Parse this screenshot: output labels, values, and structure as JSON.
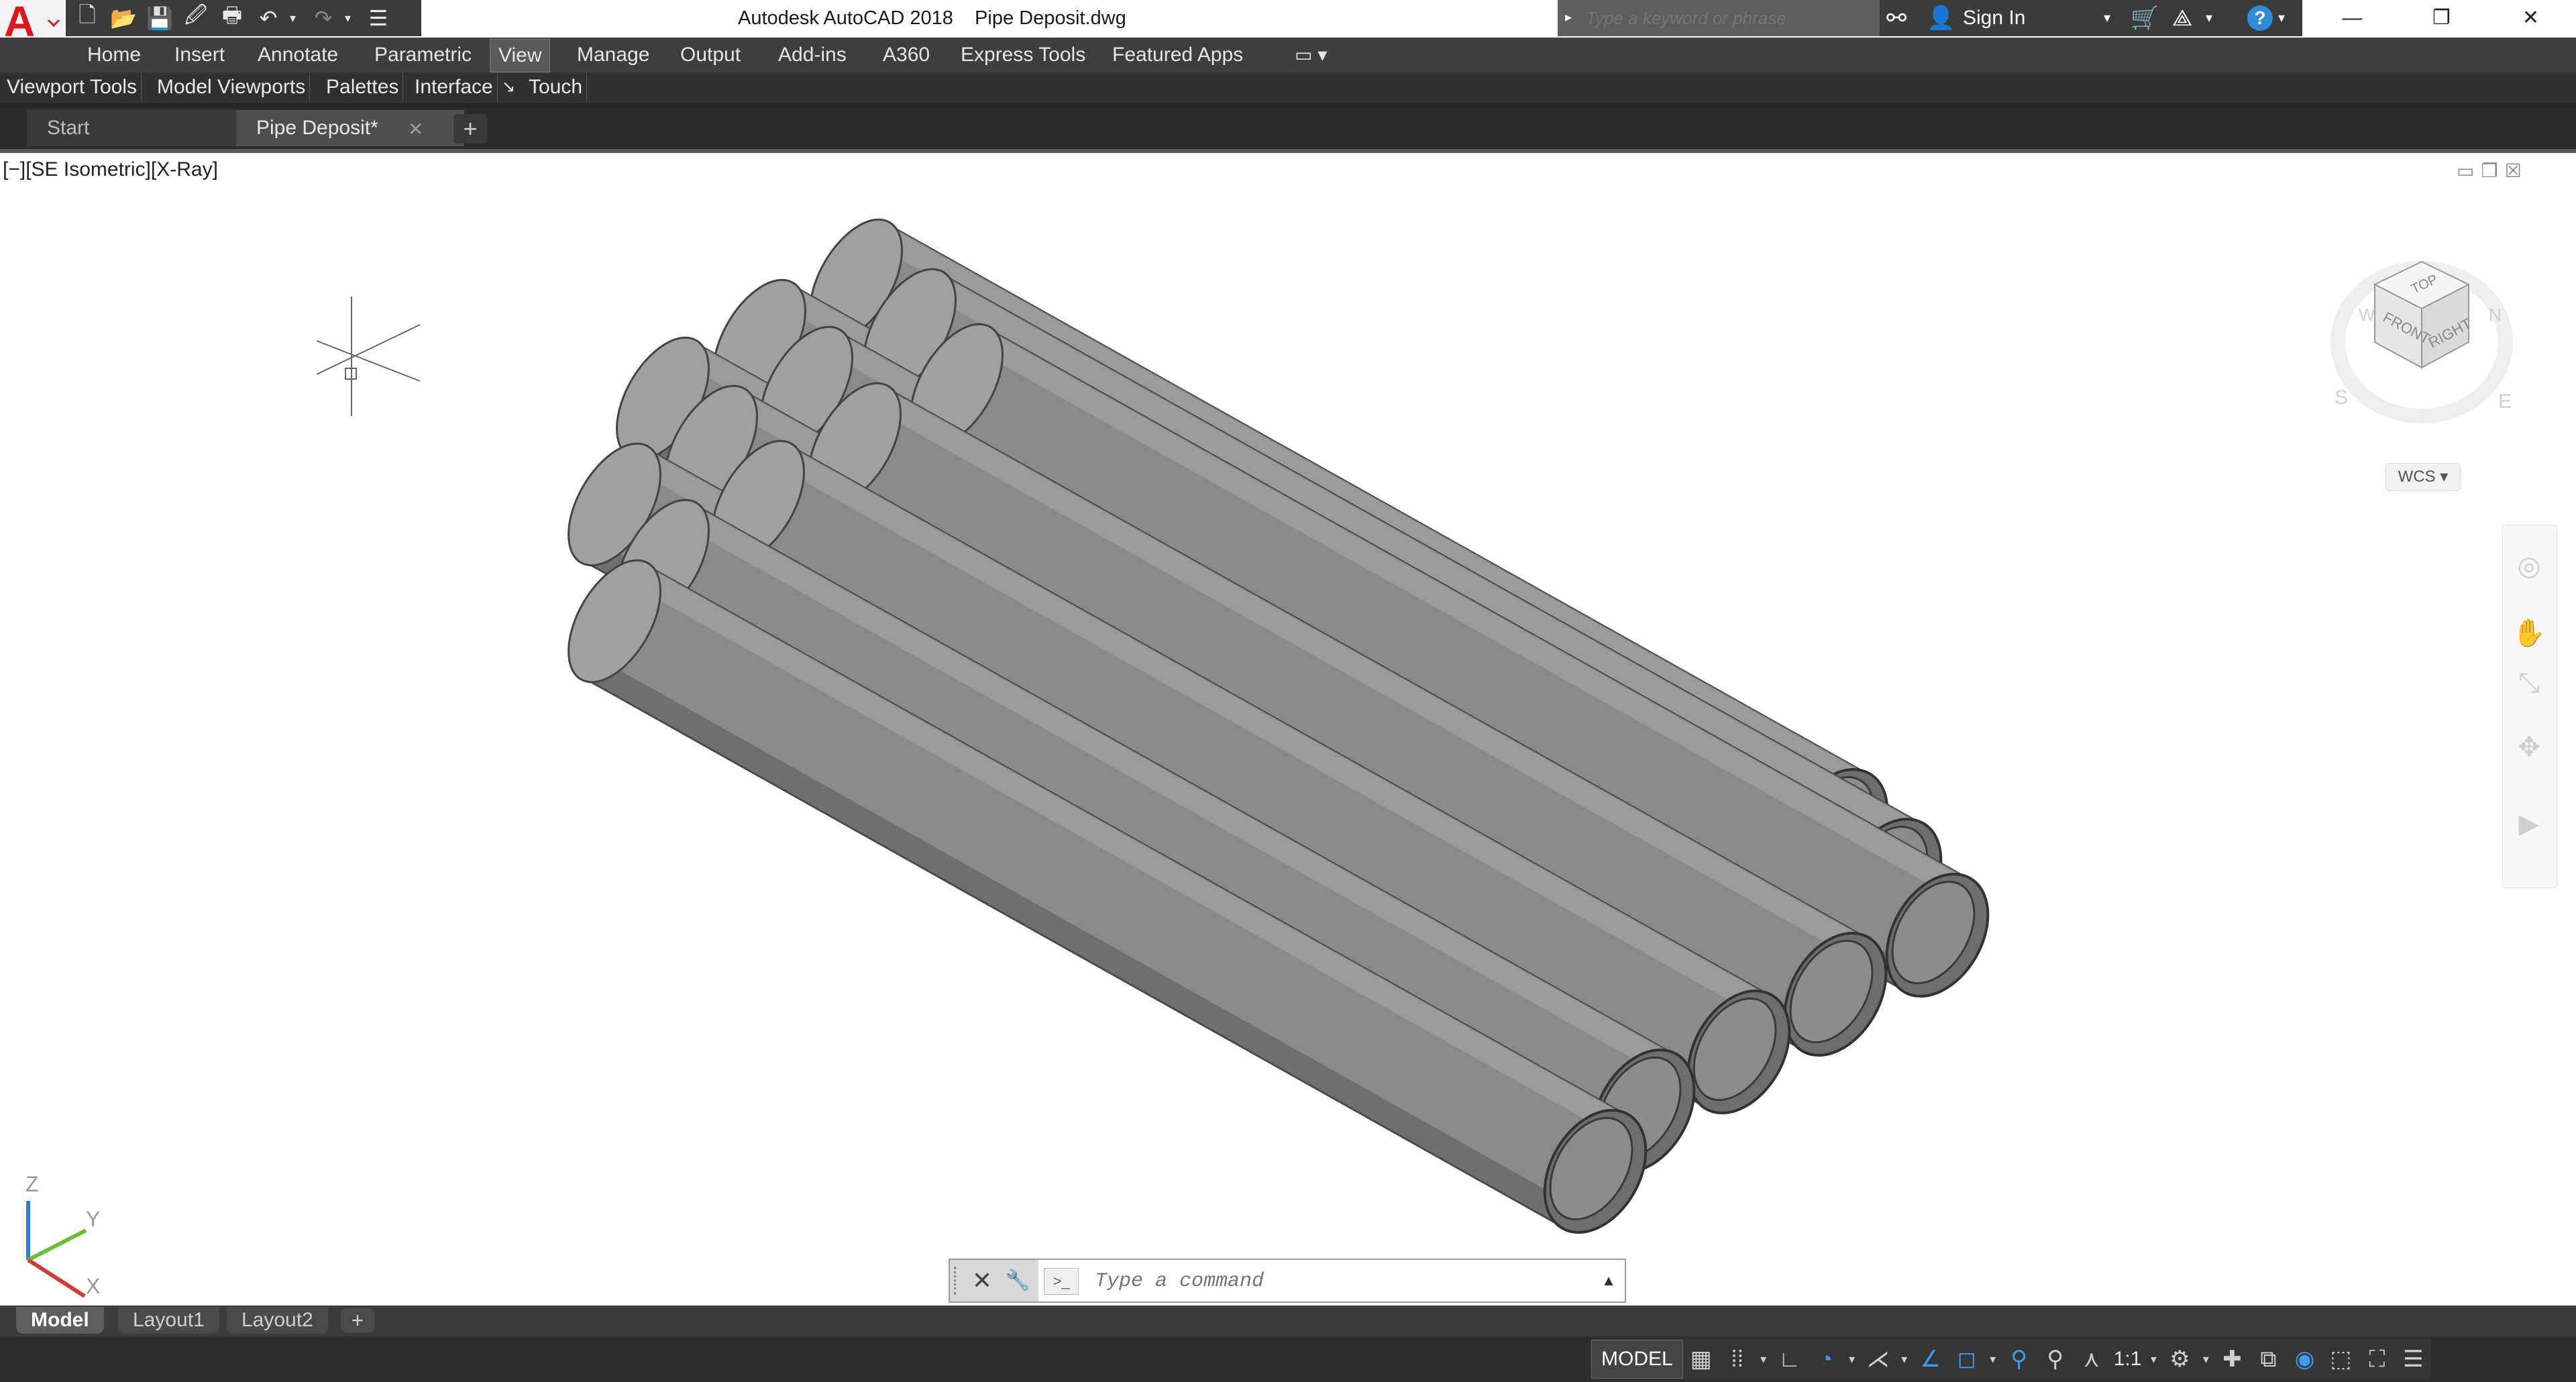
{
  "title_bar": {
    "app_title": "Autodesk AutoCAD 2018    Pipe Deposit.dwg",
    "logo_letter": "A",
    "quick_access": [
      "new-icon",
      "open-icon",
      "save-icon",
      "save-as-icon",
      "plot-icon",
      "undo-icon",
      "redo-icon",
      "customize-icon"
    ],
    "search_placeholder": "Type a keyword or phrase",
    "sign_in": "Sign In",
    "window": {
      "minimize": "—",
      "restore": "❐",
      "close": "✕"
    }
  },
  "ribbon": {
    "tabs": [
      "Home",
      "Insert",
      "Annotate",
      "Parametric",
      "View",
      "Manage",
      "Output",
      "Add-ins",
      "A360",
      "Express Tools",
      "Featured Apps"
    ],
    "active_tab": "View",
    "panels": [
      "Viewport Tools",
      "Model Viewports",
      "Palettes",
      "Interface",
      "Touch"
    ]
  },
  "file_tabs": {
    "start": "Start",
    "active": "Pipe Deposit*",
    "close": "✕",
    "add": "+"
  },
  "viewport": {
    "label": "[−][SE Isometric][X-Ray]",
    "wcs": "WCS",
    "viewcube": {
      "top": "TOP",
      "front": "FRONT",
      "right": "RIGHT",
      "compass": [
        "W",
        "N",
        "S",
        "E"
      ]
    },
    "ucs": {
      "z": "Z",
      "y": "Y",
      "x": "X"
    }
  },
  "command_line": {
    "placeholder": "Type a command",
    "close": "✕",
    "wrench": "🔧",
    "prompt": ">_",
    "up": "▲"
  },
  "layout_tabs": [
    "Model",
    "Layout1",
    "Layout2"
  ],
  "layout_add": "+",
  "status_bar": {
    "model": "MODEL",
    "scale": "1:1"
  },
  "colors": {
    "pipe_fill": "#8a8a8a",
    "pipe_dark": "#5a5a5a",
    "toolbar_bg": "#3e3e3e",
    "accent_blue": "#3d9cf0"
  }
}
